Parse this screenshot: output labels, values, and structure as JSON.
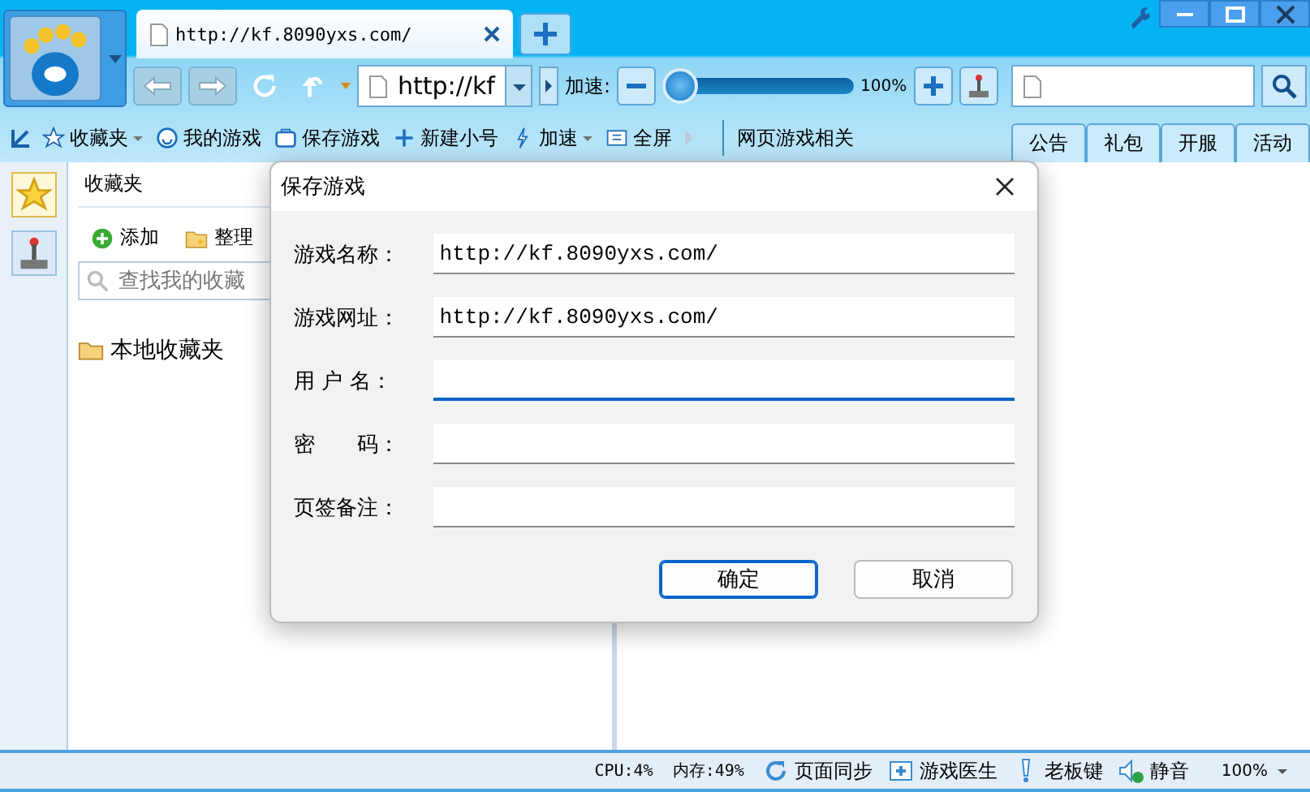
{
  "browser_tab": {
    "title": "http://kf.8090yxs.com/"
  },
  "nav": {
    "address": "http://kf",
    "speed_label": "加速:",
    "speed": {
      "level": 0.0,
      "reading": "100%"
    }
  },
  "toolbar": [
    {
      "label": "收藏夹",
      "dropdown": true
    },
    {
      "label": "我的游戏",
      "dropdown": false
    },
    {
      "label": "保存游戏",
      "dropdown": false
    },
    {
      "label": "新建小号",
      "dropdown": false
    },
    {
      "label": "加速",
      "dropdown": true
    },
    {
      "label": "全屏",
      "dropdown": false
    }
  ],
  "toolbar_section": "网页游戏相关",
  "page_tabs": [
    {
      "label": "公告"
    },
    {
      "label": "礼包"
    },
    {
      "label": "开服"
    },
    {
      "label": "活动"
    }
  ],
  "side_strip": [
    {
      "selected": true
    },
    {
      "selected": false
    }
  ],
  "sidebar": {
    "title": "收藏夹",
    "actions": [
      {
        "label": "添加"
      },
      {
        "label": "整理"
      }
    ],
    "search_placeholder": "查找我的收藏",
    "folders": [
      {
        "label": "本地收藏夹"
      }
    ]
  },
  "dialog": {
    "title": "保存游戏",
    "fields": [
      {
        "label": "游戏名称：",
        "value": "http://kf.8090yxs.com/",
        "focused": false
      },
      {
        "label": "游戏网址：",
        "value": "http://kf.8090yxs.com/",
        "focused": false
      },
      {
        "label": "用 户 名：",
        "focused": true
      },
      {
        "label": "密　　码：",
        "focused": false
      },
      {
        "label": "页签备注：",
        "focused": false
      }
    ],
    "buttons": [
      {
        "label": "确定",
        "default": true
      },
      {
        "label": "取消",
        "default": false
      }
    ]
  },
  "status_bar": {
    "cpu": "CPU:4%",
    "memory": "内存:49%",
    "items": [
      {
        "label": "页面同步"
      },
      {
        "label": "游戏医生"
      },
      {
        "label": "老板键"
      },
      {
        "label": "静音"
      }
    ],
    "zoom": "100%"
  }
}
